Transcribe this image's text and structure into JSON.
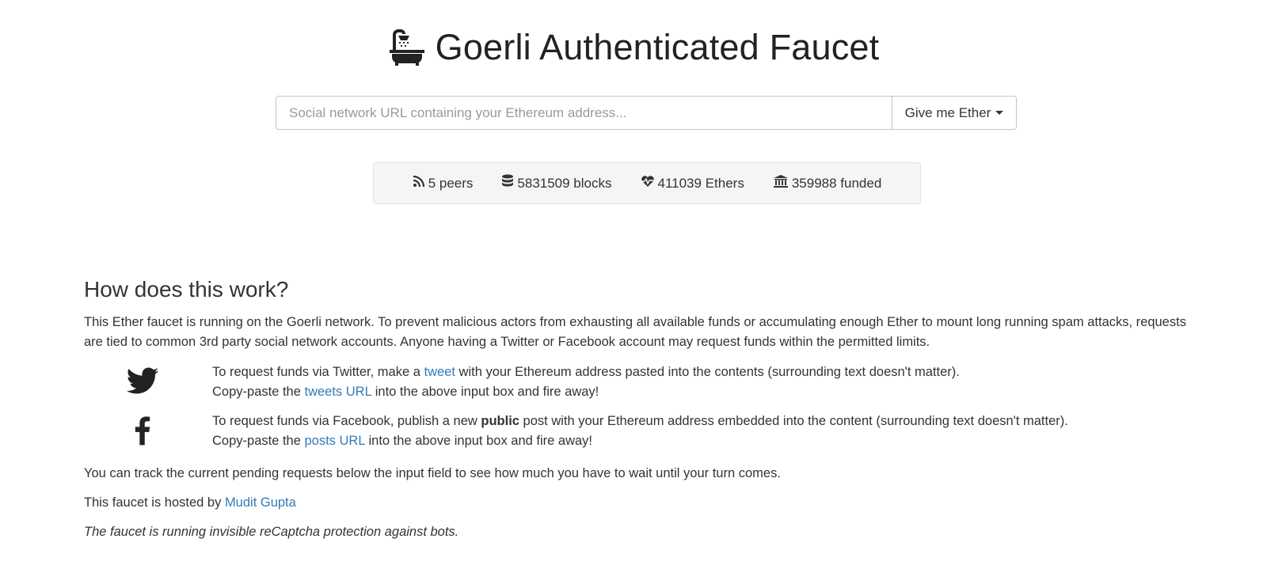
{
  "header": {
    "title": "Goerli Authenticated Faucet",
    "icon": "bath-icon"
  },
  "request": {
    "placeholder": "Social network URL containing your Ethereum address...",
    "value": "",
    "button_label": "Give me Ether"
  },
  "stats": {
    "peers": "5 peers",
    "blocks": "5831509 blocks",
    "ethers": "411039 Ethers",
    "funded": "359988 funded"
  },
  "info": {
    "heading": "How does this work?",
    "intro": "This Ether faucet is running on the Goerli network. To prevent malicious actors from exhausting all available funds or accumulating enough Ether to mount long running spam attacks, requests are tied to common 3rd party social network accounts. Anyone having a Twitter or Facebook account may request funds within the permitted limits.",
    "twitter": {
      "line1_pre": "To request funds via Twitter, make a ",
      "line1_link": "tweet",
      "line1_post": " with your Ethereum address pasted into the contents (surrounding text doesn't matter).",
      "line2_pre": "Copy-paste the ",
      "line2_link": "tweets URL",
      "line2_post": " into the above input box and fire away!"
    },
    "facebook": {
      "line1_pre": "To request funds via Facebook, publish a new ",
      "line1_bold": "public",
      "line1_post": " post with your Ethereum address embedded into the content (surrounding text doesn't matter).",
      "line2_pre": "Copy-paste the ",
      "line2_link": "posts URL",
      "line2_post": " into the above input box and fire away!"
    },
    "tracking": "You can track the current pending requests below the input field to see how much you have to wait until your turn comes.",
    "hosted_pre": "This faucet is hosted by ",
    "hosted_link": "Mudit Gupta",
    "recaptcha": "The faucet is running invisible reCaptcha protection against bots."
  },
  "colors": {
    "link": "#337ab7",
    "text": "#333333",
    "well_bg": "#f5f5f5"
  }
}
